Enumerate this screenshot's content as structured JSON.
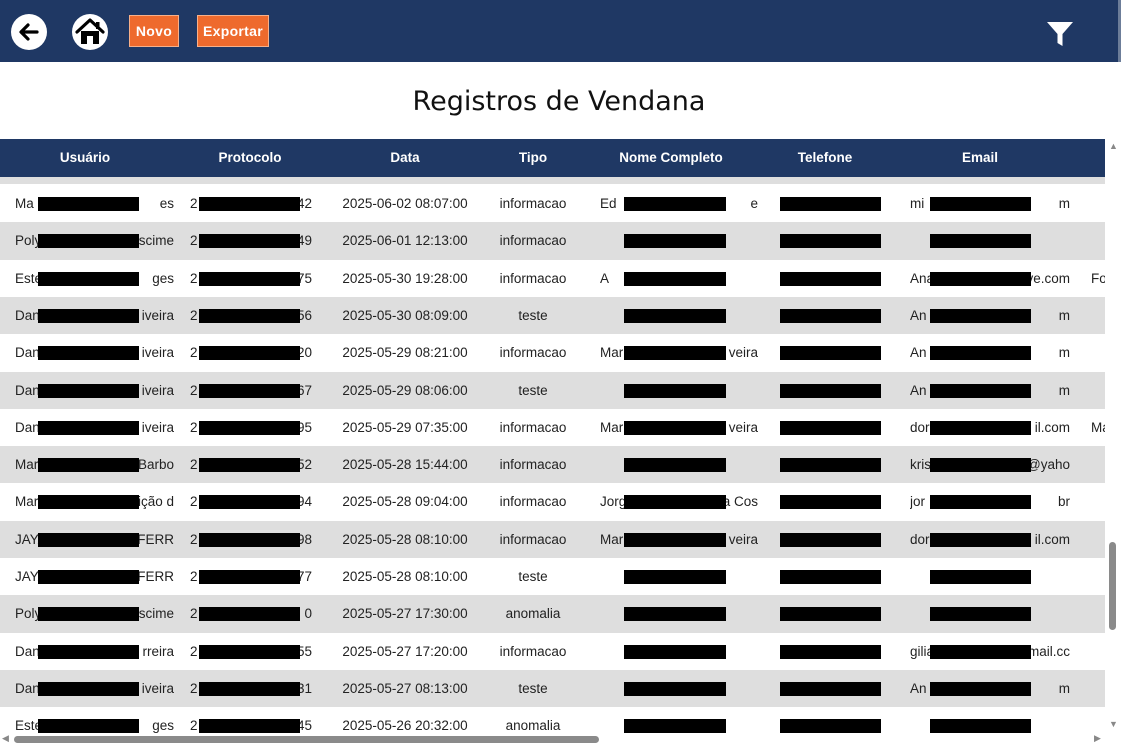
{
  "toolbar": {
    "back_icon": "arrow-left-icon",
    "home_icon": "home-icon",
    "new_label": "Novo",
    "export_label": "Exportar",
    "filter_icon": "filter-icon"
  },
  "page_title": "Registros de Vendana",
  "table": {
    "columns": [
      "Usuário",
      "Protocolo",
      "Data",
      "Tipo",
      "Nome Completo",
      "Telefone",
      "Email"
    ],
    "rows": [
      {
        "usuario_a": "Ma",
        "usuario_b": "es",
        "protocolo_a": "2",
        "protocolo_b": "42",
        "data": "2025-06-02 08:07:00",
        "tipo": "informacao",
        "nome_a": "Ed",
        "nome_b": "e",
        "telefone_a": "",
        "email_a": "mi",
        "email_b": "m",
        "extra": ""
      },
      {
        "usuario_a": "Poly",
        "usuario_b": "ascime",
        "protocolo_a": "2",
        "protocolo_b": "49",
        "data": "2025-06-01 12:13:00",
        "tipo": "informacao",
        "nome_a": "",
        "nome_b": "",
        "telefone_a": "",
        "email_a": "",
        "email_b": "",
        "extra": ""
      },
      {
        "usuario_a": "Este",
        "usuario_b": "ges",
        "protocolo_a": "2",
        "protocolo_b": "75",
        "data": "2025-05-30 19:28:00",
        "tipo": "informacao",
        "nome_a": "A",
        "nome_b": "",
        "telefone_a": "",
        "email_a": "Ana",
        "email_b": "ve.com",
        "extra": "Fo"
      },
      {
        "usuario_a": "Dan",
        "usuario_b": "iveira",
        "protocolo_a": "2",
        "protocolo_b": "56",
        "data": "2025-05-30 08:09:00",
        "tipo": "teste",
        "nome_a": "",
        "nome_b": "",
        "telefone_a": "",
        "email_a": "An",
        "email_b": "m",
        "extra": ""
      },
      {
        "usuario_a": "Dan",
        "usuario_b": "iveira",
        "protocolo_a": "2",
        "protocolo_b": "20",
        "data": "2025-05-29 08:21:00",
        "tipo": "informacao",
        "nome_a": "Mar",
        "nome_b": "veira",
        "telefone_a": "",
        "email_a": "An",
        "email_b": "m",
        "extra": ""
      },
      {
        "usuario_a": "Dan",
        "usuario_b": "iveira",
        "protocolo_a": "2",
        "protocolo_b": "67",
        "data": "2025-05-29 08:06:00",
        "tipo": "teste",
        "nome_a": "",
        "nome_b": "",
        "telefone_a": "",
        "email_a": "An",
        "email_b": "m",
        "extra": ""
      },
      {
        "usuario_a": "Dan",
        "usuario_b": "iveira",
        "protocolo_a": "2",
        "protocolo_b": "95",
        "data": "2025-05-29 07:35:00",
        "tipo": "informacao",
        "nome_a": "Mar",
        "nome_b": "veira",
        "telefone_a": "",
        "email_a": "dor",
        "email_b": "il.com",
        "extra": "Ma"
      },
      {
        "usuario_a": "Mar",
        "usuario_b": "Barbo",
        "protocolo_a": "2",
        "protocolo_b": "52",
        "data": "2025-05-28 15:44:00",
        "tipo": "informacao",
        "nome_a": "",
        "nome_b": "",
        "telefone_a": "",
        "email_a": "kris",
        "email_b": "@yaho",
        "extra": ""
      },
      {
        "usuario_a": "Mar",
        "usuario_b": "ição d",
        "protocolo_a": "2",
        "protocolo_b": "94",
        "data": "2025-05-28 09:04:00",
        "tipo": "informacao",
        "nome_a": "Jorg",
        "nome_b": "a Cos",
        "telefone_a": "",
        "email_a": "jor",
        "email_b": "br",
        "extra": ""
      },
      {
        "usuario_a": "JAYA",
        "usuario_b": "FERR",
        "protocolo_a": "2",
        "protocolo_b": "98",
        "data": "2025-05-28 08:10:00",
        "tipo": "informacao",
        "nome_a": "Mar",
        "nome_b": "veira",
        "telefone_a": "",
        "email_a": "dor",
        "email_b": "il.com",
        "extra": ""
      },
      {
        "usuario_a": "JAYA",
        "usuario_b": "FERR",
        "protocolo_a": "2",
        "protocolo_b": "77",
        "data": "2025-05-28 08:10:00",
        "tipo": "teste",
        "nome_a": "",
        "nome_b": "",
        "telefone_a": "",
        "email_a": "",
        "email_b": "",
        "extra": ""
      },
      {
        "usuario_a": "Poly",
        "usuario_b": "scime",
        "protocolo_a": "2",
        "protocolo_b": "0",
        "data": "2025-05-27 17:30:00",
        "tipo": "anomalia",
        "nome_a": "",
        "nome_b": "",
        "telefone_a": "",
        "email_a": "",
        "email_b": "",
        "extra": ""
      },
      {
        "usuario_a": "Dan",
        "usuario_b": "rreira",
        "protocolo_a": "2",
        "protocolo_b": "55",
        "data": "2025-05-27 17:20:00",
        "tipo": "informacao",
        "nome_a": "",
        "nome_b": "",
        "telefone_a": "",
        "email_a": "gilia",
        "email_b": "mail.cc",
        "extra": ""
      },
      {
        "usuario_a": "Dan",
        "usuario_b": "iveira",
        "protocolo_a": "2",
        "protocolo_b": "31",
        "data": "2025-05-27 08:13:00",
        "tipo": "teste",
        "nome_a": "",
        "nome_b": "",
        "telefone_a": "",
        "email_a": "An",
        "email_b": "m",
        "extra": ""
      },
      {
        "usuario_a": "Este",
        "usuario_b": "ges",
        "protocolo_a": "2",
        "protocolo_b": "45",
        "data": "2025-05-26 20:32:00",
        "tipo": "anomalia",
        "nome_a": "",
        "nome_b": "",
        "telefone_a": "",
        "email_a": "",
        "email_b": "",
        "extra": ""
      }
    ]
  },
  "scrollbars": {
    "vertical_position": 0.72,
    "horizontal_position": 0.0
  },
  "colors": {
    "header": "#1f3864",
    "accent_button": "#ee6a2d",
    "row_alt": "#dedede",
    "redaction": "#000000"
  }
}
